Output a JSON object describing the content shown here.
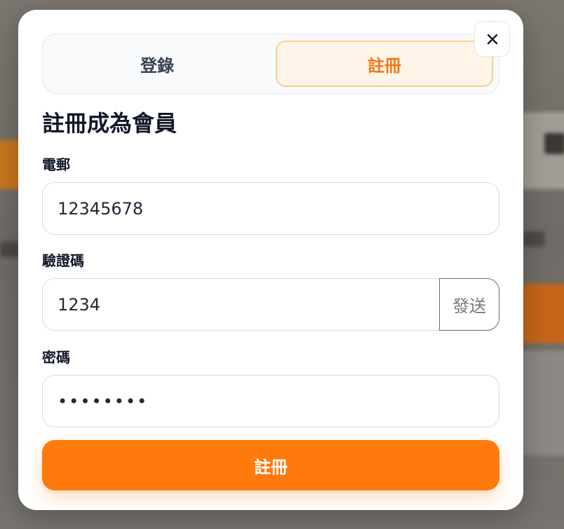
{
  "tabs": {
    "login_label": "登錄",
    "register_label": "註冊",
    "active": "register"
  },
  "form": {
    "title": "註冊成為會員",
    "email_label": "電郵",
    "email_value": "12345678",
    "code_label": "驗證碼",
    "code_value": "1234",
    "send_label": "發送",
    "password_label": "密碼",
    "password_value": "••••••••",
    "submit_label": "註冊"
  },
  "icons": {
    "close": "close-icon"
  },
  "colors": {
    "accent": "#ff7a0c",
    "active_tab_bg": "#fff4e8",
    "active_tab_text": "#f07815",
    "text_primary": "#111827"
  }
}
